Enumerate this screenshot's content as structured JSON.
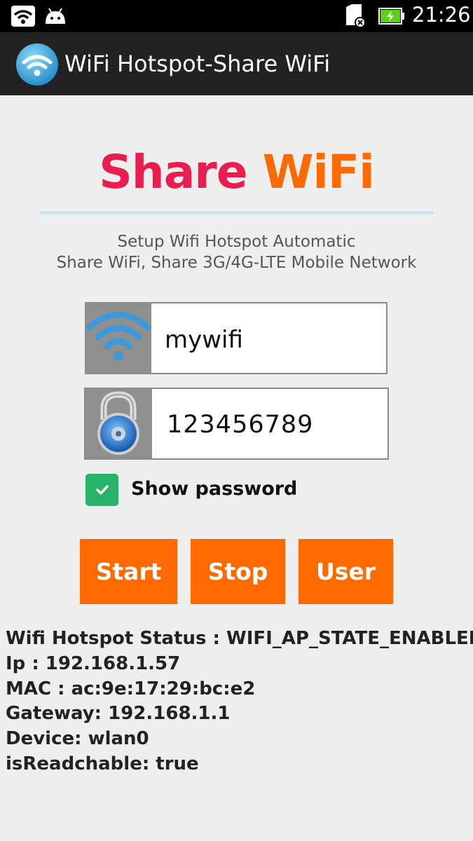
{
  "status_bar": {
    "time": "21:26",
    "icons": [
      "wifi-icon",
      "android-icon",
      "sd-card-icon",
      "battery-charging-icon"
    ]
  },
  "action_bar": {
    "title": "WiFi Hotspot-Share WiFi",
    "logo_icon": "wifi-logo-icon"
  },
  "heading": {
    "word1": "Share",
    "word2": "WiFi",
    "word1_color": "#e91e4f",
    "word2_color": "#ff6a00"
  },
  "subtitle": {
    "line1": "Setup Wifi Hotspot Automatic",
    "line2": "Share WiFi, Share 3G/4G-LTE Mobile Network"
  },
  "form": {
    "ssid": {
      "value": "mywifi",
      "icon": "wifi-icon"
    },
    "password": {
      "value": "123456789",
      "icon": "padlock-icon"
    },
    "show_password": {
      "label": "Show password",
      "checked": true
    }
  },
  "buttons": {
    "start": "Start",
    "stop": "Stop",
    "user": "User",
    "color": "#ff6a00"
  },
  "status_info": {
    "lines": [
      "Wifi Hotspot Status : WIFI_AP_STATE_ENABLED",
      "Ip : 192.168.1.57",
      "MAC : ac:9e:17:29:bc:e2",
      "Gateway: 192.168.1.1",
      "Device: wlan0",
      "isReadchable: true"
    ]
  }
}
